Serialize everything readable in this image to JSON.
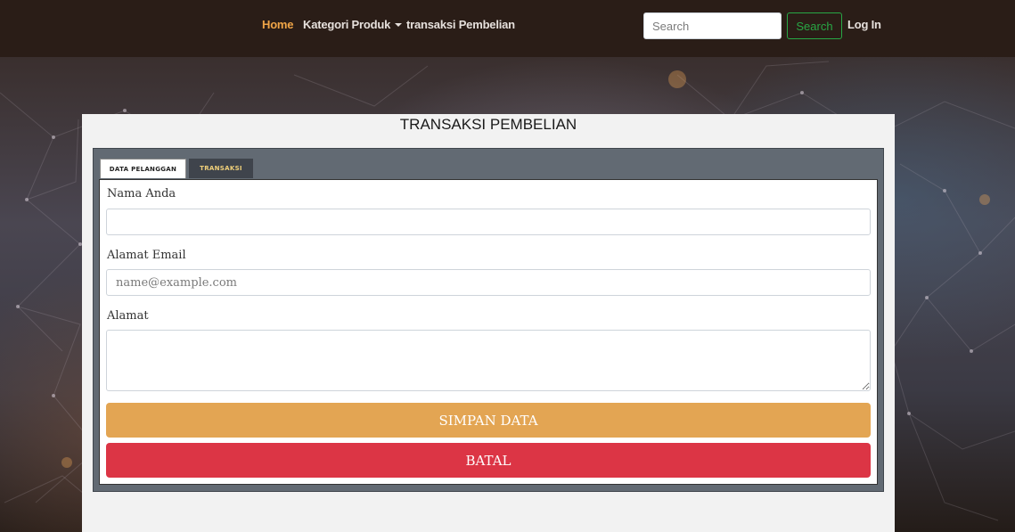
{
  "navbar": {
    "links": {
      "home": "Home",
      "kategori": "Kategori Produk",
      "transaksi": "transaksi Pembelian"
    },
    "search_placeholder": "Search",
    "search_button": "Search",
    "login": "Log In",
    "active_color": "#f0a547"
  },
  "card": {
    "title": "TRANSAKSI PEMBELIAN",
    "tabs": [
      "DATA PELANGGAN",
      "TRANSAKSI"
    ],
    "active_tab": "DATA PELANGGAN",
    "form": {
      "name_label": "Nama Anda",
      "name_value": "",
      "email_label": "Alamat Email",
      "email_placeholder": "name@example.com",
      "address_label": "Alamat",
      "address_value": "",
      "save_button": "SIMPAN DATA",
      "cancel_button": "BATAL"
    }
  },
  "colors": {
    "navbar_bg": "#2a1d17",
    "save_button": "#e3a553",
    "cancel_button": "#dc3545",
    "search_accent": "#28a745"
  }
}
